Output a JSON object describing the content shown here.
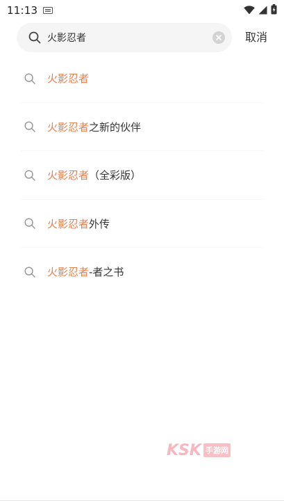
{
  "status_bar": {
    "time": "11:13"
  },
  "search": {
    "value": "火影忍者",
    "cancel_label": "取消"
  },
  "suggestions": [
    {
      "highlight": "火影忍者",
      "rest": ""
    },
    {
      "highlight": "火影忍者",
      "rest": "之新的伙伴"
    },
    {
      "highlight": "火影忍者",
      "rest": "（全彩版）"
    },
    {
      "highlight": "火影忍者",
      "rest": "外传"
    },
    {
      "highlight": "火影忍者",
      "rest": "-者之书"
    }
  ],
  "watermark": {
    "brand": "KSK",
    "badge": "手游网"
  },
  "colors": {
    "highlight": "#e8804e",
    "search_bg": "#f5f5f5",
    "text": "#333333"
  },
  "icons": [
    "notification-icon",
    "wifi-icon",
    "signal-icon",
    "battery-icon",
    "search-icon",
    "clear-icon"
  ]
}
